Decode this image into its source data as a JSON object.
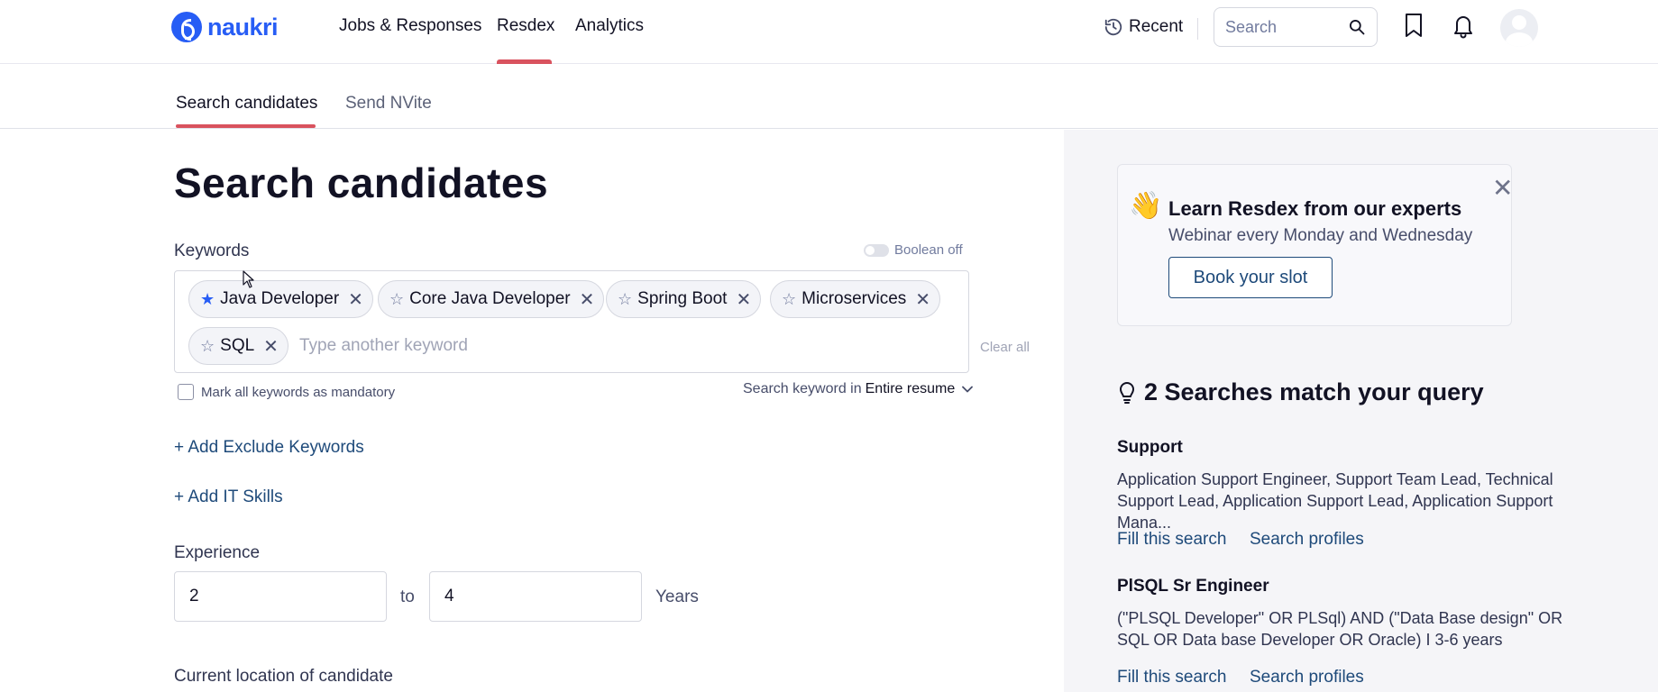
{
  "brand": {
    "name": "naukri",
    "color": "#275df5",
    "accent": "#d9525e"
  },
  "nav": {
    "items": [
      "Jobs & Responses",
      "Resdex",
      "Analytics"
    ],
    "active": "Resdex",
    "recent_label": "Recent",
    "search_placeholder": "Search"
  },
  "subtabs": {
    "items": [
      "Search candidates",
      "Send NVite"
    ],
    "active": "Search candidates"
  },
  "main": {
    "title": "Search candidates",
    "keywords_label": "Keywords",
    "boolean_label": "Boolean off",
    "keywords": [
      {
        "label": "Java Developer",
        "starred": true
      },
      {
        "label": "Core Java Developer",
        "starred": false
      },
      {
        "label": "Spring Boot",
        "starred": false
      },
      {
        "label": "Microservices",
        "starred": false
      },
      {
        "label": "SQL",
        "starred": false
      }
    ],
    "keyword_placeholder": "Type another keyword",
    "clear_all": "Clear all",
    "mandatory_label": "Mark all keywords as mandatory",
    "search_in_label": "Search keyword in",
    "search_in_value": "Entire resume",
    "add_exclude": "+ Add Exclude Keywords",
    "add_it_skills": "+ Add IT Skills",
    "experience_label": "Experience",
    "exp_min": "2",
    "exp_to": "to",
    "exp_max": "4",
    "exp_unit": "Years",
    "location_label": "Current location of candidate"
  },
  "promo": {
    "emoji": "👋",
    "title": "Learn Resdex from our experts",
    "subtitle": "Webinar every Monday and Wednesday",
    "button": "Book your slot"
  },
  "matches": {
    "heading": "2 Searches match your query",
    "items": [
      {
        "title": "Support",
        "desc": "Application Support Engineer, Support Team Lead, Technical Support Lead, Application Support Lead, Application Support Mana...",
        "fill": "Fill this search",
        "search": "Search profiles"
      },
      {
        "title": "PlSQL Sr Engineer",
        "desc": "(\"PLSQL Developer\" OR PLSql) AND (\"Data Base design\" OR SQL OR Data base Developer OR Oracle) I 3-6 years",
        "fill": "Fill this search",
        "search": "Search profiles"
      }
    ]
  }
}
